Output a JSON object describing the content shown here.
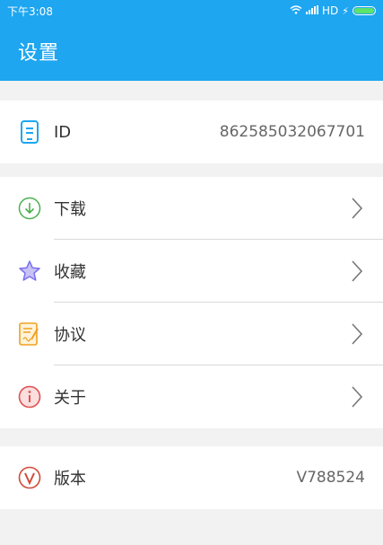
{
  "status_bar": {
    "time": "下午3:08",
    "network": "HD",
    "battery_level": 1.0
  },
  "app_bar": {
    "title": "设置"
  },
  "id_section": {
    "label": "ID",
    "value": "862585032067701"
  },
  "menu": [
    {
      "label": "下载",
      "icon": "download-icon",
      "color": "#4caf50"
    },
    {
      "label": "收藏",
      "icon": "star-icon",
      "color": "#7a6ff0"
    },
    {
      "label": "协议",
      "icon": "agreement-icon",
      "color": "#f0a020"
    },
    {
      "label": "关于",
      "icon": "info-icon",
      "color": "#e05050"
    }
  ],
  "version_section": {
    "label": "版本",
    "value": "V788524",
    "icon": "version-icon"
  },
  "colors": {
    "primary": "#1ea6f0",
    "background": "#f2f2f2"
  }
}
